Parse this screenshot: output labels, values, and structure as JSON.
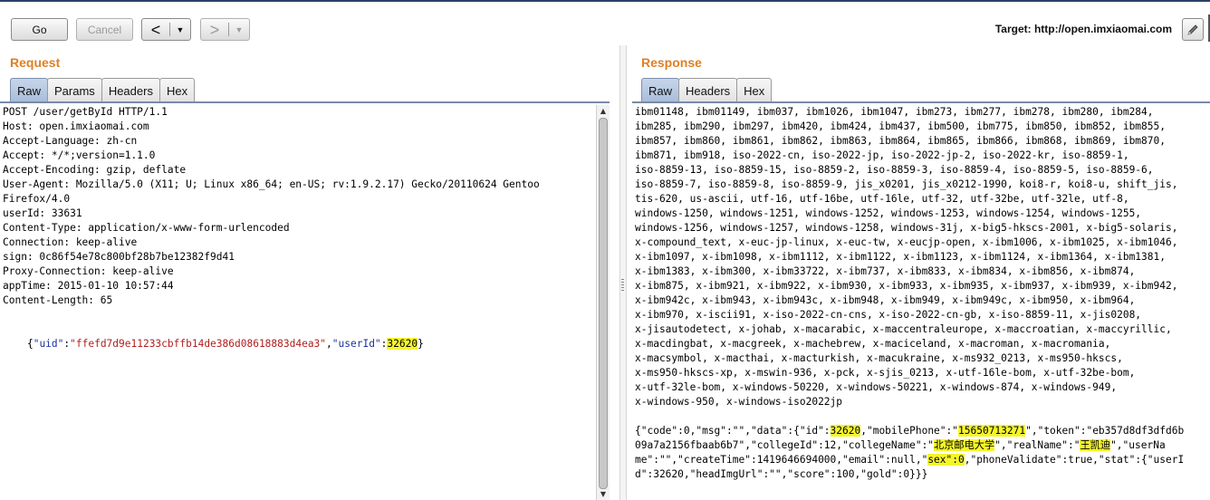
{
  "toolbar": {
    "go_label": "Go",
    "cancel_label": "Cancel",
    "back_arrow": "<",
    "forward_arrow": ">",
    "dropdown_glyph": "▼",
    "target_text": "Target: http://open.imxiaomai.com"
  },
  "request": {
    "title": "Request",
    "tabs": [
      "Raw",
      "Params",
      "Headers",
      "Hex"
    ],
    "active_tab": "Raw",
    "lines": [
      "POST /user/getById HTTP/1.1",
      "Host: open.imxiaomai.com",
      "Accept-Language: zh-cn",
      "Accept: */*;version=1.1.0",
      "Accept-Encoding: gzip, deflate",
      "User-Agent: Mozilla/5.0 (X11; U; Linux x86_64; en-US; rv:1.9.2.17) Gecko/20110624 Gentoo",
      "Firefox/4.0",
      "userId: 33631",
      "Content-Type: application/x-www-form-urlencoded",
      "Connection: keep-alive",
      "sign: 0c86f54e78c800bf28b7be12382f9d41",
      "Proxy-Connection: keep-alive",
      "appTime: 2015-01-10 10:57:44",
      "Content-Length: 65"
    ],
    "body": {
      "open": "{",
      "key1": "\"uid\"",
      "colon1": ":",
      "val1": "\"ffefd7d9e11233cbffb14de386d08618883d4ea3\"",
      "comma": ",",
      "key2": "\"userId\"",
      "colon2": ":",
      "val2": "32620",
      "close": "}"
    }
  },
  "response": {
    "title": "Response",
    "tabs": [
      "Raw",
      "Headers",
      "Hex"
    ],
    "active_tab": "Raw",
    "lines": [
      "ibm01148, ibm01149, ibm037, ibm1026, ibm1047, ibm273, ibm277, ibm278, ibm280, ibm284,",
      "ibm285, ibm290, ibm297, ibm420, ibm424, ibm437, ibm500, ibm775, ibm850, ibm852, ibm855,",
      "ibm857, ibm860, ibm861, ibm862, ibm863, ibm864, ibm865, ibm866, ibm868, ibm869, ibm870,",
      "ibm871, ibm918, iso-2022-cn, iso-2022-jp, iso-2022-jp-2, iso-2022-kr, iso-8859-1,",
      "iso-8859-13, iso-8859-15, iso-8859-2, iso-8859-3, iso-8859-4, iso-8859-5, iso-8859-6,",
      "iso-8859-7, iso-8859-8, iso-8859-9, jis_x0201, jis_x0212-1990, koi8-r, koi8-u, shift_jis,",
      "tis-620, us-ascii, utf-16, utf-16be, utf-16le, utf-32, utf-32be, utf-32le, utf-8,",
      "windows-1250, windows-1251, windows-1252, windows-1253, windows-1254, windows-1255,",
      "windows-1256, windows-1257, windows-1258, windows-31j, x-big5-hkscs-2001, x-big5-solaris,",
      "x-compound_text, x-euc-jp-linux, x-euc-tw, x-eucjp-open, x-ibm1006, x-ibm1025, x-ibm1046,",
      "x-ibm1097, x-ibm1098, x-ibm1112, x-ibm1122, x-ibm1123, x-ibm1124, x-ibm1364, x-ibm1381,",
      "x-ibm1383, x-ibm300, x-ibm33722, x-ibm737, x-ibm833, x-ibm834, x-ibm856, x-ibm874,",
      "x-ibm875, x-ibm921, x-ibm922, x-ibm930, x-ibm933, x-ibm935, x-ibm937, x-ibm939, x-ibm942,",
      "x-ibm942c, x-ibm943, x-ibm943c, x-ibm948, x-ibm949, x-ibm949c, x-ibm950, x-ibm964,",
      "x-ibm970, x-iscii91, x-iso-2022-cn-cns, x-iso-2022-cn-gb, x-iso-8859-11, x-jis0208,",
      "x-jisautodetect, x-johab, x-macarabic, x-maccentraleurope, x-maccroatian, x-maccyrillic,",
      "x-macdingbat, x-macgreek, x-machebrew, x-maciceland, x-macroman, x-macromania,",
      "x-macsymbol, x-macthai, x-macturkish, x-macukraine, x-ms932_0213, x-ms950-hkscs,",
      "x-ms950-hkscs-xp, x-mswin-936, x-pck, x-sjis_0213, x-utf-16le-bom, x-utf-32be-bom,",
      "x-utf-32le-bom, x-windows-50220, x-windows-50221, x-windows-874, x-windows-949,",
      "x-windows-950, x-windows-iso2022jp"
    ],
    "json": {
      "l1a": "{\"code\":0,\"msg\":\"\",\"data\":{\"id\":",
      "l1_id": "32620",
      "l1b": ",\"mobilePhone\":\"",
      "l1_phone": "15650713271",
      "l1c": "\",\"token\":\"eb357d8df3dfd6b",
      "l2a": "09a7a2156fbaab6b7\",\"collegeId\":12,\"collegeName\":\"",
      "l2_college": "北京邮电大学",
      "l2b": "\",\"realName\":\"",
      "l2_name": "王凯迪",
      "l2c": "\",\"userNa",
      "l3a": "me\":\"\",\"createTime\":1419646694000,\"email\":null,\"",
      "l3_sex": "sex\":0",
      "l3b": ",\"phoneValidate\":true,\"stat\":{\"userI",
      "l4": "d\":32620,\"headImgUrl\":\"\",\"score\":100,\"gold\":0}}}"
    }
  },
  "colors": {
    "accent_orange": "#e07f22",
    "highlight_yellow": "#f5f52b",
    "json_key_blue": "#1a2fa0",
    "json_value_red": "#b01e1e"
  }
}
